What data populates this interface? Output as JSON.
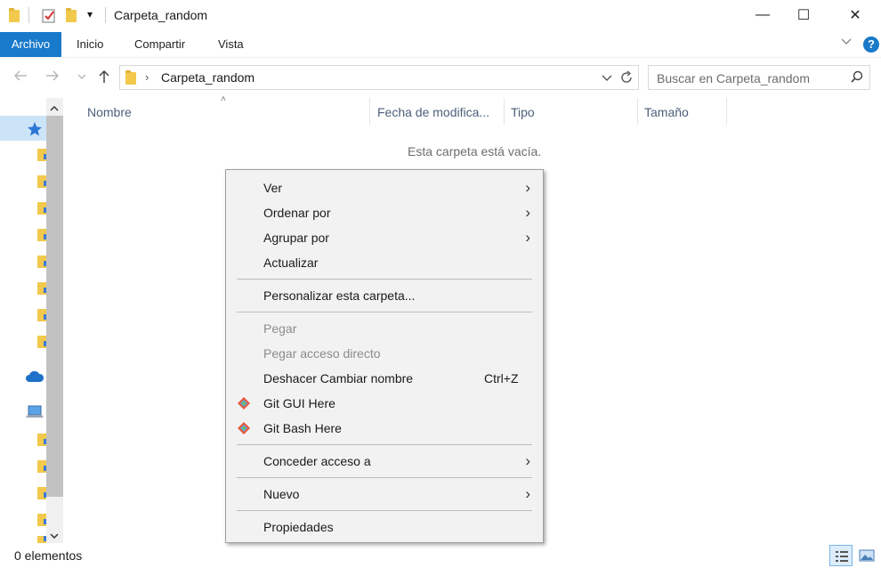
{
  "window": {
    "title": "Carpeta_random",
    "minimize": "—",
    "maximize": "☐",
    "close": "✕"
  },
  "ribbon": {
    "tabs": [
      "Archivo",
      "Inicio",
      "Compartir",
      "Vista"
    ],
    "help": "?"
  },
  "address": {
    "path": "Carpeta_random",
    "search_placeholder": "Buscar en Carpeta_random"
  },
  "columns": [
    "Nombre",
    "Fecha de modifica...",
    "Tipo",
    "Tamaño"
  ],
  "empty_message": "Esta carpeta está vacía.",
  "context_menu": {
    "items": [
      {
        "label": "Ver",
        "submenu": true
      },
      {
        "label": "Ordenar por",
        "submenu": true
      },
      {
        "label": "Agrupar por",
        "submenu": true
      },
      {
        "label": "Actualizar"
      },
      {
        "label": "Personalizar esta carpeta..."
      },
      {
        "label": "Pegar",
        "disabled": true
      },
      {
        "label": "Pegar acceso directo",
        "disabled": true
      },
      {
        "label": "Deshacer Cambiar nombre",
        "shortcut": "Ctrl+Z"
      },
      {
        "label": "Git GUI Here",
        "icon": "git-icon"
      },
      {
        "label": "Git Bash Here",
        "icon": "git-icon"
      },
      {
        "label": "Conceder acceso a",
        "submenu": true
      },
      {
        "label": "Nuevo",
        "submenu": true
      },
      {
        "label": "Propiedades"
      }
    ]
  },
  "status": {
    "count": "0 elementos"
  },
  "colors": {
    "accent": "#1979ca",
    "menu_bg": "#f2f2f2",
    "header_text": "#4c607a"
  }
}
